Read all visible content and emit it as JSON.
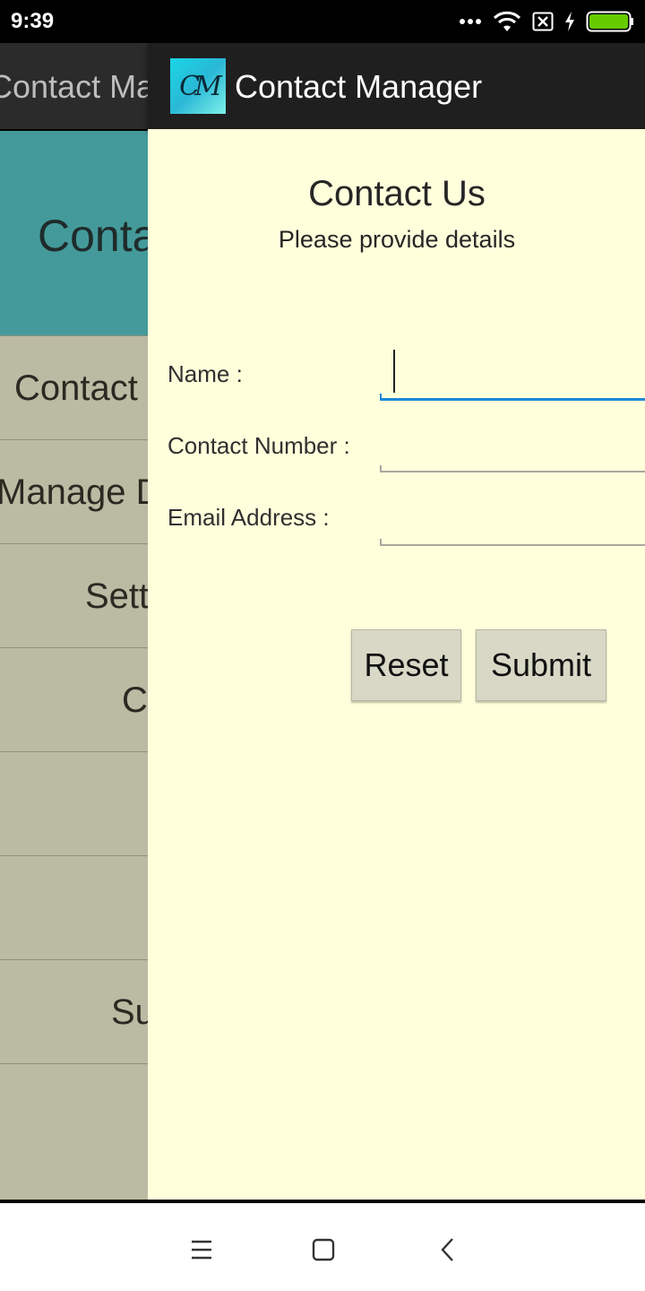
{
  "status_bar": {
    "time": "9:39",
    "icons": [
      "more-dots-icon",
      "wifi-icon",
      "no-sim-icon",
      "charging-icon",
      "battery-icon"
    ],
    "battery_color": "#66cc00"
  },
  "background_activity": {
    "toolbar_title": "Contact Manager",
    "header_title": "Contact Us",
    "menu_items": [
      "Contact Us",
      "Manage Data",
      "Settings",
      "Contact",
      "",
      "",
      "Submit",
      ""
    ]
  },
  "app_bar": {
    "logo_text": "CM",
    "title": "Contact Manager"
  },
  "form": {
    "title": "Contact Us",
    "subtitle": "Please provide details",
    "name_label": "Name :",
    "name_value": "",
    "contact_label": "Contact Number :",
    "contact_value": "",
    "email_label": "Email Address :",
    "email_value": "",
    "reset_label": "Reset",
    "submit_label": "Submit"
  },
  "colors": {
    "panel_background": "#ffffdc",
    "header_teal": "#449a9a",
    "menu_background": "#bbbaa3",
    "active_input": "#1e88d8",
    "button_background": "#d8d8c6"
  },
  "nav_bar": {
    "buttons": [
      "menu-icon",
      "home-icon",
      "back-icon"
    ]
  }
}
